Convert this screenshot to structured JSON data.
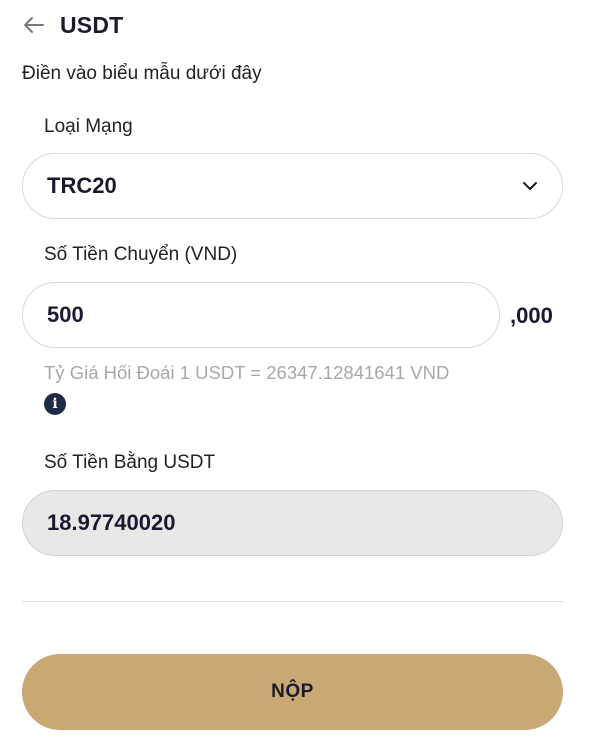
{
  "header": {
    "back_icon": "arrow-left-icon",
    "title": "USDT"
  },
  "form": {
    "subtitle": "Điền vào biểu mẫu dưới đây",
    "network": {
      "label": "Loại Mạng",
      "selected": "TRC20",
      "icon": "chevron-down-icon"
    },
    "amount": {
      "label": "Số Tiền Chuyển (VND)",
      "value": "500",
      "suffix": ",000"
    },
    "rate": {
      "text": "Tỷ Giá Hối Đoái 1 USDT = 26347.12841641 VND",
      "icon": "info-icon"
    },
    "usdt_amount": {
      "label": "Số Tiền Bằng USDT",
      "value": "18.97740020"
    },
    "submit_label": "NỘP"
  },
  "colors": {
    "accent": "#c9a873",
    "text_dark": "#1a1a2e",
    "muted": "#a8a8a8",
    "readonly_bg": "#e8e8e8"
  }
}
